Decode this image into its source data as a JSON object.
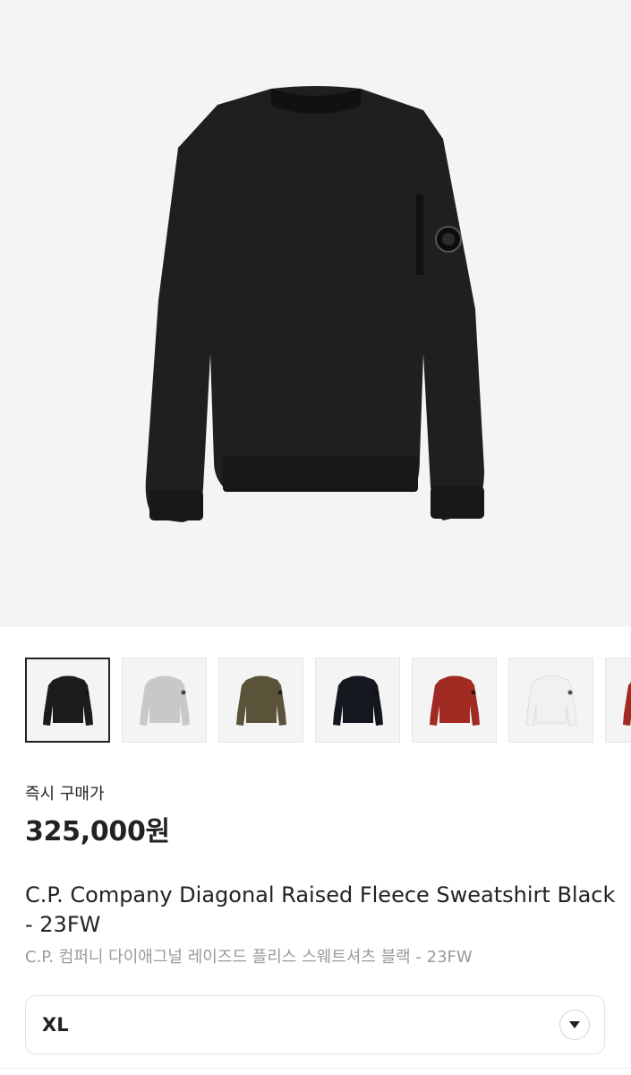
{
  "product": {
    "image_icon": "sweatshirt-image",
    "color_options": [
      {
        "name": "black",
        "color": "#1c1c1c",
        "selected": true
      },
      {
        "name": "grey",
        "color": "#c8c8c8",
        "selected": false
      },
      {
        "name": "olive",
        "color": "#5a5339",
        "selected": false
      },
      {
        "name": "navy",
        "color": "#15171f",
        "selected": false
      },
      {
        "name": "red",
        "color": "#a12a23",
        "selected": false
      },
      {
        "name": "white",
        "color": "#f1f1f1",
        "selected": false
      },
      {
        "name": "partial",
        "color": "#a12a23",
        "selected": false
      }
    ],
    "buy_label": "즉시 구매가",
    "price": "325,000원",
    "title_en": "C.P. Company Diagonal Raised Fleece Sweatshirt Black - 23FW",
    "title_ko": "C.P. 컴퍼니 다이애그널 레이즈드 플리스 스웨트셔츠 블랙 - 23FW"
  },
  "size_select": {
    "value": "XL",
    "icon": "chevron-down-icon"
  },
  "colors": {
    "hero_bg": "#f4f4f4",
    "text": "#222222",
    "subtext": "#9a9a9a"
  }
}
